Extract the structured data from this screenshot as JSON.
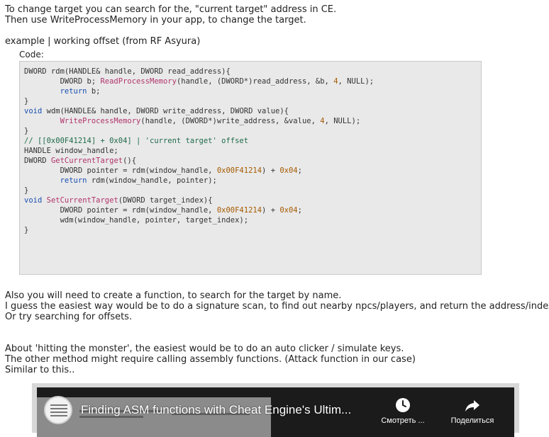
{
  "intro": {
    "line1": "To change target you can search for the, \"current target\" address in CE.",
    "line2": "Then use WriteProcessMemory in your app, to change the target."
  },
  "example_heading": "example | working offset (from RF Asyura)",
  "code_label": "Code:",
  "code_lines": [
    [
      [
        "DWORD rdm(HANDLE& handle, DWORD read_address){",
        ""
      ]
    ],
    [
      [
        "        DWORD b; ",
        ""
      ],
      [
        "ReadProcessMemory",
        "fn"
      ],
      [
        "(handle, (DWORD*)read_address, &b, ",
        ""
      ],
      [
        "4",
        "num"
      ],
      [
        ", NULL);",
        ""
      ]
    ],
    [
      [
        "        ",
        ""
      ],
      [
        "return",
        "kw"
      ],
      [
        " b;",
        ""
      ]
    ],
    [
      [
        "}",
        ""
      ]
    ],
    [
      [
        "void",
        "kw"
      ],
      [
        " wdm(HANDLE& handle, DWORD write_address, DWORD value){",
        ""
      ]
    ],
    [
      [
        "        ",
        ""
      ],
      [
        "WriteProcessMemory",
        "fn"
      ],
      [
        "(handle, (DWORD*)write_address, &value, ",
        ""
      ],
      [
        "4",
        "num"
      ],
      [
        ", NULL);",
        ""
      ]
    ],
    [
      [
        "}",
        ""
      ]
    ],
    [
      [
        "// [[0x00F41214] + 0x04] | 'current target' offset",
        "cmt"
      ]
    ],
    [
      [
        "HANDLE window_handle;",
        ""
      ]
    ],
    [
      [
        "DWORD ",
        ""
      ],
      [
        "GetCurrentTarget",
        "fn"
      ],
      [
        "(){",
        ""
      ]
    ],
    [
      [
        "        DWORD pointer = rdm(window_handle, ",
        ""
      ],
      [
        "0x00F41214",
        "num"
      ],
      [
        ") + ",
        ""
      ],
      [
        "0x04",
        "num"
      ],
      [
        ";",
        ""
      ]
    ],
    [
      [
        "        ",
        ""
      ],
      [
        "return",
        "kw"
      ],
      [
        " rdm(window_handle, pointer);",
        ""
      ]
    ],
    [
      [
        "}",
        ""
      ]
    ],
    [
      [
        "void",
        "kw"
      ],
      [
        " ",
        ""
      ],
      [
        "SetCurrentTarget",
        "fn"
      ],
      [
        "(DWORD target_index){",
        ""
      ]
    ],
    [
      [
        "        DWORD pointer = rdm(window_handle, ",
        ""
      ],
      [
        "0x00F41214",
        "num"
      ],
      [
        ") + ",
        ""
      ],
      [
        "0x04",
        "num"
      ],
      [
        ";",
        ""
      ]
    ],
    [
      [
        "        wdm(window_handle, pointer, target_index);",
        ""
      ]
    ],
    [
      [
        "}",
        ""
      ]
    ]
  ],
  "also": {
    "line1": "Also you will need to create a function, to search for the target by name.",
    "line2": "I guess the easiest way would be to do a signature scan, to find out nearby npcs/players, and return the address/index.",
    "line3": "Or try searching for offsets."
  },
  "hitting": {
    "line1": "About 'hitting the monster', the easiest would be to do an auto clicker / simulate keys.",
    "line2": "The other method might require calling assembly functions. (Attack function in our case)",
    "line3": "Similar to this.."
  },
  "video": {
    "title": "Finding ASM functions with Cheat Engine's Ultim...",
    "watch_later_label": "Смотреть ...",
    "share_label": "Поделиться",
    "watch_later_icon": "clock-icon",
    "share_icon": "share-arrow-icon"
  }
}
